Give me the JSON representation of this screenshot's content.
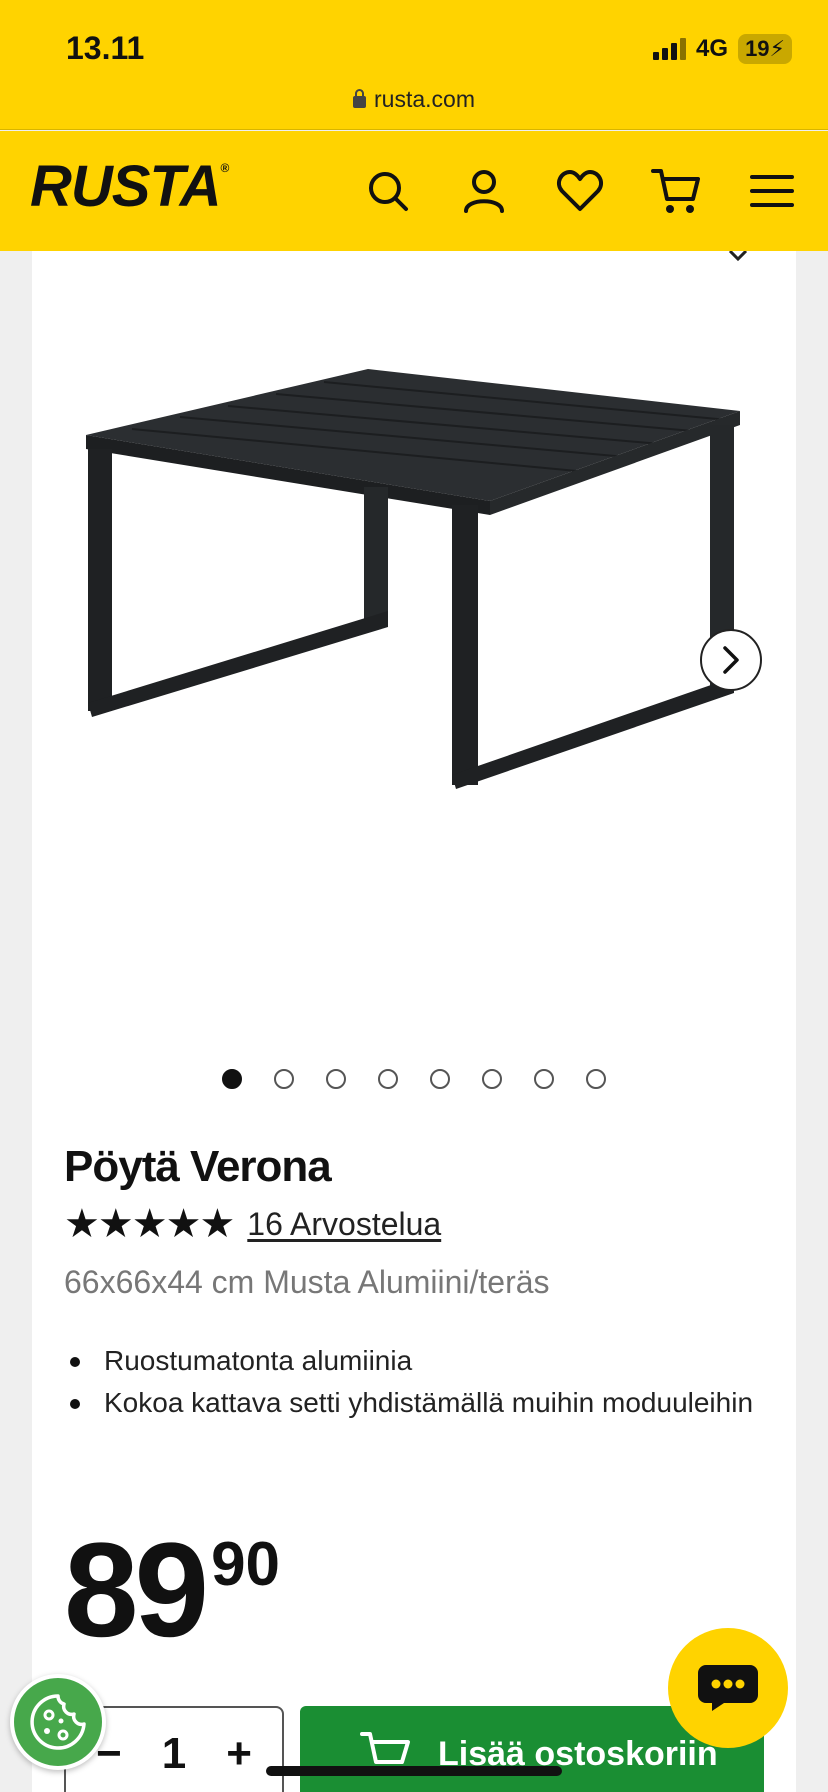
{
  "status_bar": {
    "time": "13.11",
    "network": "4G",
    "battery": "19"
  },
  "browser": {
    "url": "rusta.com"
  },
  "header": {
    "logo": "RUSTA",
    "logo_mark": "®",
    "icons": [
      "search-icon",
      "account-icon",
      "heart-icon",
      "cart-icon",
      "menu-icon"
    ]
  },
  "gallery": {
    "total_images": 8,
    "active_index": 0
  },
  "product": {
    "title": "Pöytä Verona",
    "stars": "★★★★★",
    "rating": 5,
    "reviews_link": "16 Arvostelua",
    "subtitle": "66x66x44 cm Musta Alumiini/teräs",
    "features": [
      "Ruostumatonta alumiinia",
      "Kokoa kattava setti yhdistämällä muihin moduuleihin"
    ],
    "price_main": "89",
    "price_cents": "90"
  },
  "purchase": {
    "minus_label": "−",
    "quantity": "1",
    "plus_label": "+",
    "add_to_cart_label": "Lisää ostoskoriin"
  },
  "colors": {
    "brand_yellow": "#ffd300",
    "cart_green": "#1a8e33",
    "cookie_green": "#47a84b"
  }
}
